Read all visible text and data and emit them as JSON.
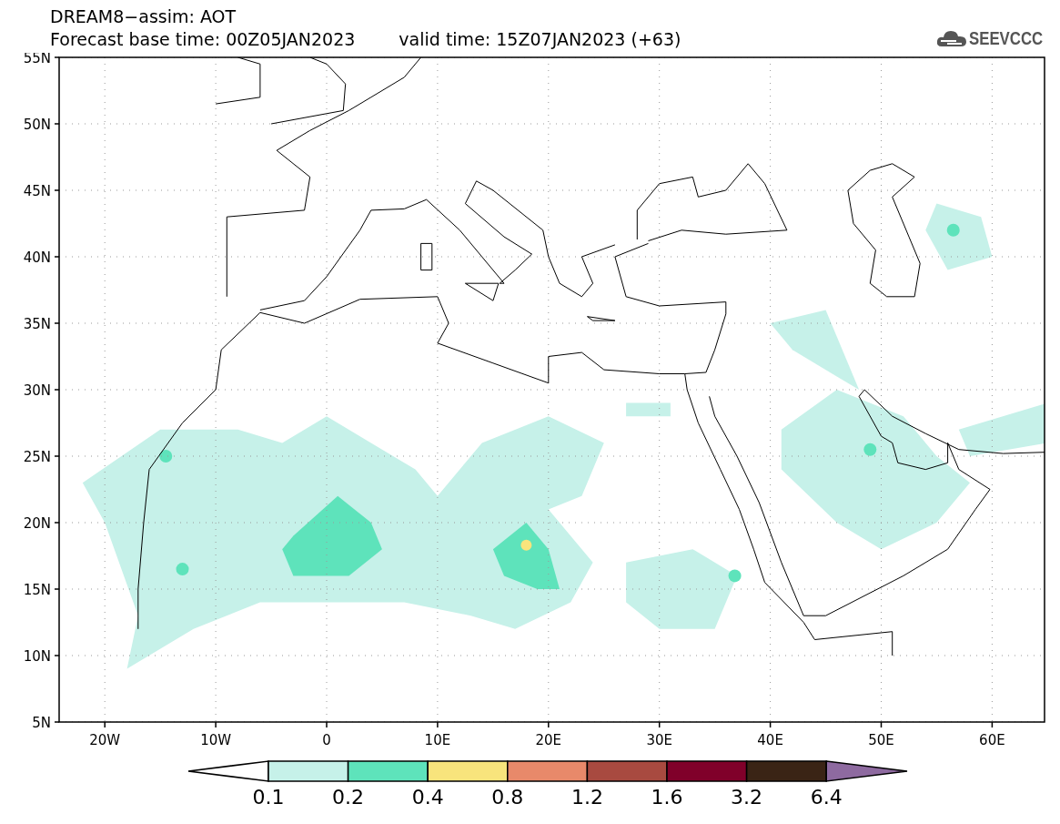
{
  "header": {
    "title": "DREAM8−assim: AOT",
    "base_time": "Forecast base time: 00Z05JAN2023",
    "valid_time": "valid time: 15Z07JAN2023 (+63)"
  },
  "logo": {
    "text": "SEEVCCC"
  },
  "map": {
    "lat_labels": [
      "55N",
      "50N",
      "45N",
      "40N",
      "35N",
      "30N",
      "25N",
      "20N",
      "15N",
      "10N",
      "5N"
    ],
    "lon_labels": [
      "20W",
      "10W",
      "0",
      "10E",
      "20E",
      "30E",
      "40E",
      "50E",
      "60E"
    ]
  },
  "colorbar": {
    "segments": [
      {
        "kind": "under",
        "color": "#ffffff"
      },
      {
        "kind": "box",
        "color": "#c6f1e9"
      },
      {
        "kind": "box",
        "color": "#5ee3bb"
      },
      {
        "kind": "box",
        "color": "#f8e47c"
      },
      {
        "kind": "box",
        "color": "#e8896a"
      },
      {
        "kind": "box",
        "color": "#a84a40"
      },
      {
        "kind": "box",
        "color": "#80002a"
      },
      {
        "kind": "box",
        "color": "#3a2415"
      },
      {
        "kind": "over",
        "color": "#8e6aa0"
      }
    ],
    "labels": [
      "0.1",
      "0.2",
      "0.4",
      "0.8",
      "1.2",
      "1.6",
      "3.2",
      "6.4"
    ]
  }
}
